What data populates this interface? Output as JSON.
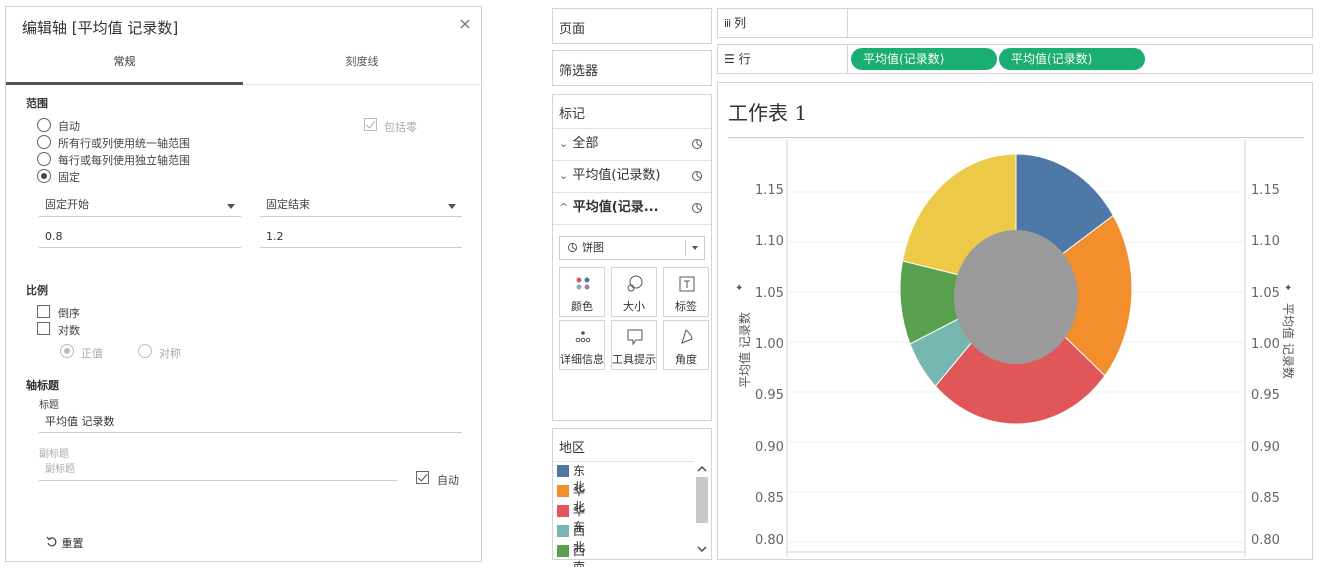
{
  "dialog": {
    "title": "编辑轴 [平均值 记录数]",
    "tabs": [
      "常规",
      "刻度线"
    ],
    "range": {
      "section": "范围",
      "options": [
        "自动",
        "所有行或列使用统一轴范围",
        "每行或每列使用独立轴范围",
        "固定"
      ],
      "selected": 3,
      "include_zero": "包括零",
      "fixed_start_label": "固定开始",
      "fixed_end_label": "固定结束",
      "start_value": "0.8",
      "end_value": "1.2"
    },
    "scale": {
      "section": "比例",
      "reversed": "倒序",
      "logarithmic": "对数",
      "positive": "正值",
      "symmetric": "对称"
    },
    "axis_title": {
      "section": "轴标题",
      "title_label": "标题",
      "title_value": "平均值 记录数",
      "subtitle_label": "副标题",
      "subtitle_placeholder": "副标题",
      "auto": "自动"
    },
    "reset": "重置"
  },
  "cards": {
    "pages": "页面",
    "filters": "筛选器",
    "marks": {
      "title": "标记",
      "rows": [
        "全部",
        "平均值(记录数)",
        "平均值(记录..."
      ],
      "mark_type": "饼图",
      "buttons": [
        "颜色",
        "大小",
        "标签",
        "详细信息",
        "工具提示",
        "角度"
      ]
    },
    "legend": {
      "title": "地区",
      "items": [
        {
          "name": "东北",
          "color": "#4e79a7"
        },
        {
          "name": "华北",
          "color": "#f28e2b"
        },
        {
          "name": "华东",
          "color": "#e15759"
        },
        {
          "name": "西北",
          "color": "#76b7b2"
        },
        {
          "name": "西南",
          "color": "#59a14f"
        }
      ]
    }
  },
  "shelves": {
    "columns_label": "列",
    "rows_label": "行",
    "row_pills": [
      "平均值(记录数)",
      "平均值(记录数)"
    ]
  },
  "sheet": {
    "title": "工作表 1",
    "axis_title": "平均值 记录数",
    "ticks": [
      "1.15",
      "1.10",
      "1.05",
      "1.00",
      "0.95",
      "0.90",
      "0.85",
      "0.80"
    ]
  },
  "chart_data": {
    "type": "pie",
    "ylim": [
      0.8,
      1.15
    ],
    "categories": [
      "东北",
      "华北",
      "华东",
      "西北",
      "西南",
      "(黄色)"
    ],
    "colors": [
      "#4e79a7",
      "#f28e2b",
      "#e15759",
      "#76b7b2",
      "#59a14f",
      "#edc948"
    ],
    "share_degrees": [
      57,
      73,
      94,
      22,
      36,
      78
    ],
    "donut_hole_color": "#9b9b9b"
  },
  "pill_color": "#1aae72"
}
